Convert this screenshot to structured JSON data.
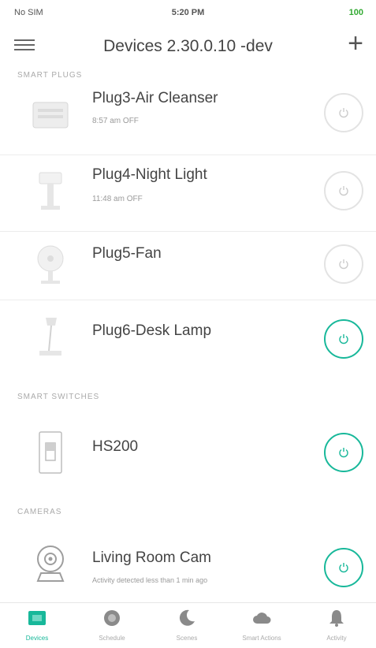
{
  "status_bar": {
    "carrier": "No SIM",
    "time": "5:20 PM",
    "battery": "100"
  },
  "header": {
    "title": "Devices 2.30.0.10 -dev",
    "add_symbol": "+"
  },
  "sections": {
    "smart_plugs": "SMART PLUGS",
    "smart_switches": "SMART SWITCHES",
    "cameras": "CAMERAS"
  },
  "devices": [
    {
      "name": "Plug3-Air Cleanser",
      "sub": "8:57 am OFF",
      "on": false
    },
    {
      "name": "Plug4-Night Light",
      "sub": "11:48 am OFF",
      "on": false
    },
    {
      "name": "Plug5-Fan",
      "sub": "",
      "on": false
    },
    {
      "name": "Plug6-Desk Lamp",
      "sub": "",
      "on": true
    },
    {
      "name": "HS200",
      "sub": "",
      "on": true
    },
    {
      "name": "Living Room Cam",
      "sub": "Activity detected less than 1 min ago",
      "on": true
    }
  ],
  "tabs": [
    {
      "label": "Devices",
      "icon": "devices-icon",
      "active": true
    },
    {
      "label": "Schedule",
      "icon": "schedule-icon",
      "active": false
    },
    {
      "label": "Scenes",
      "icon": "scenes-icon",
      "active": false
    },
    {
      "label": "Smart Actions",
      "icon": "cloud-icon",
      "active": false
    },
    {
      "label": "Activity",
      "icon": "bell-icon",
      "active": false
    }
  ],
  "colors": {
    "accent": "#18b89a",
    "off_ring": "#e3e3e3",
    "text": "#444444"
  }
}
